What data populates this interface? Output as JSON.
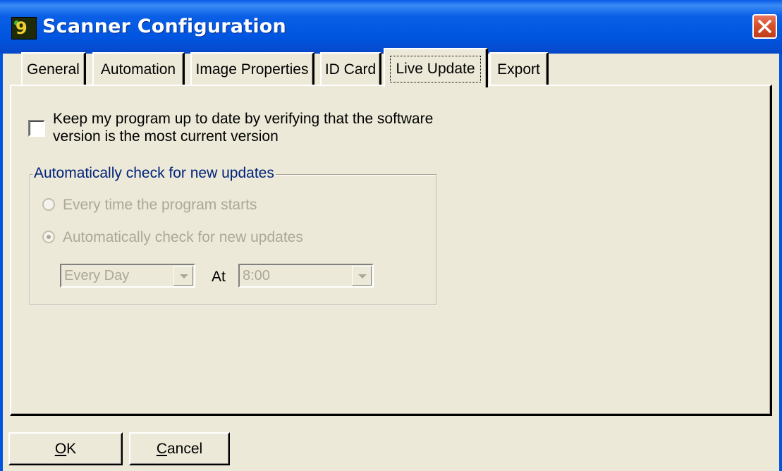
{
  "window": {
    "title": "Scanner Configuration",
    "icon": "app-logo-icon",
    "close": "close-icon"
  },
  "tabs": [
    {
      "label": "General",
      "active": false
    },
    {
      "label": "Automation",
      "active": false
    },
    {
      "label": "Image Properties",
      "active": false
    },
    {
      "label": "ID Card",
      "active": false
    },
    {
      "label": "Live Update",
      "active": true
    },
    {
      "label": "Export",
      "active": false
    }
  ],
  "live_update": {
    "keep_up_to_date": {
      "label_line1": "Keep my program up to date by verifying that the software",
      "label_line2": "version is the most current version",
      "checked": false
    },
    "group": {
      "title": "Automatically check for new updates",
      "enabled": false,
      "options": [
        {
          "label": "Every time the program starts",
          "selected": false
        },
        {
          "label": "Automatically check for new updates",
          "selected": true
        }
      ],
      "frequency": {
        "value": "Every Day"
      },
      "at_label": "At",
      "time": {
        "value": "8:00"
      }
    }
  },
  "buttons": {
    "ok": {
      "mnemonic": "O",
      "rest": "K"
    },
    "cancel": {
      "mnemonic": "C",
      "rest": "ancel"
    }
  },
  "colors": {
    "titlebar": "#0055e0",
    "dialog_bg": "#ece9d8",
    "disabled_text": "#aca899",
    "group_title": "#00227a",
    "close_button": "#d8502c"
  }
}
